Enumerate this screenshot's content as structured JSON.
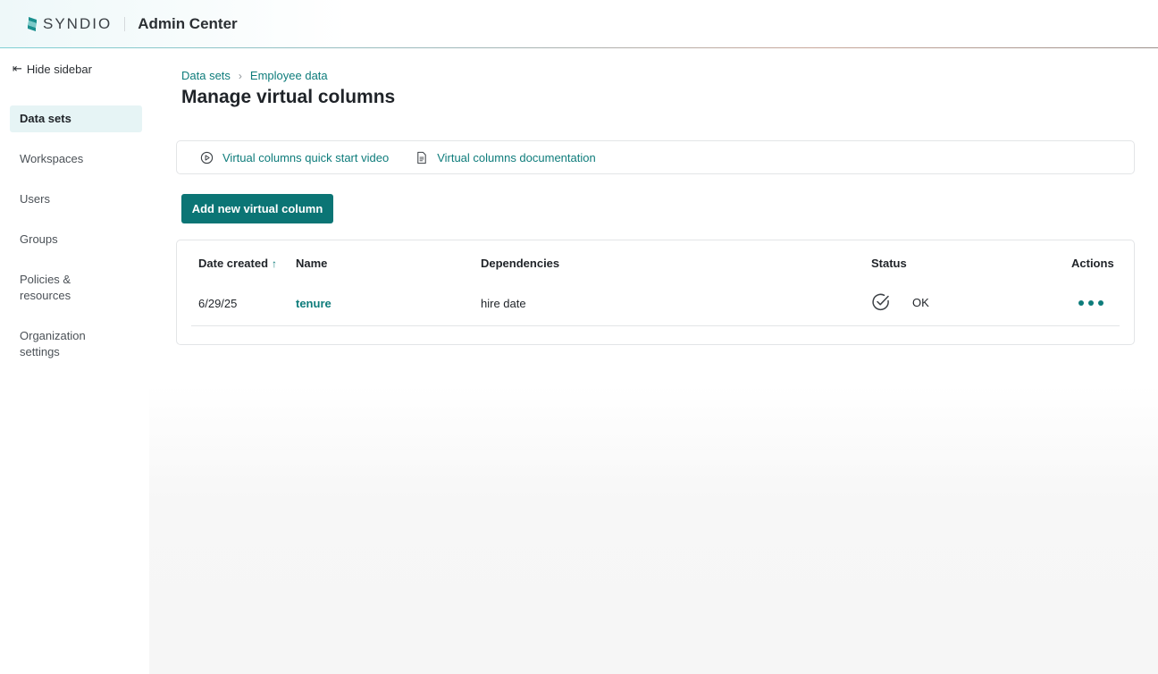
{
  "header": {
    "brand": "SYNDIO",
    "title": "Admin Center"
  },
  "sidebar": {
    "hide_label": "Hide sidebar",
    "items": [
      {
        "label": "Data sets",
        "active": true
      },
      {
        "label": "Workspaces"
      },
      {
        "label": "Users"
      },
      {
        "label": "Groups"
      },
      {
        "label": "Policies & resources"
      },
      {
        "label": "Organization settings"
      }
    ]
  },
  "breadcrumb": [
    "Data sets",
    "Employee data"
  ],
  "page_title": "Manage virtual columns",
  "links": {
    "video": "Virtual columns quick start video",
    "docs": "Virtual columns documentation"
  },
  "add_button": "Add new virtual column",
  "table": {
    "columns": [
      "Date created",
      "Name",
      "Dependencies",
      "Status",
      "Actions"
    ],
    "sort_column": "Date created",
    "sort_direction": "ascending",
    "rows": [
      {
        "date_created": "6/29/25",
        "name": "tenure",
        "dependencies": "hire date",
        "status": "OK"
      }
    ]
  },
  "colors": {
    "accent": "#0e7c7b",
    "button": "#0b7575",
    "active_nav_bg": "#e6f4f5"
  },
  "icons": {
    "brand_mark": "syndio-logo-icon",
    "hide_sidebar": "arrow-left-bar-icon",
    "video": "play-circle-icon",
    "docs": "document-icon",
    "sort": "arrow-up-icon",
    "status": "check-circle-icon",
    "actions": "more-horizontal-icon"
  }
}
